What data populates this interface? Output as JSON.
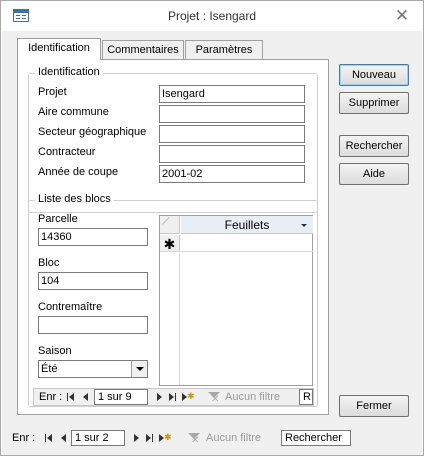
{
  "window": {
    "title": "Projet : Isengard",
    "close_glyph": "✕"
  },
  "tabs": [
    {
      "label": "Identification",
      "active": true
    },
    {
      "label": "Commentaires",
      "active": false
    },
    {
      "label": "Paramètres",
      "active": false
    }
  ],
  "identification": {
    "group_label": "Identification",
    "fields": [
      {
        "label": "Projet",
        "value": "Isengard"
      },
      {
        "label": "Aire commune",
        "value": ""
      },
      {
        "label": "Secteur géographique",
        "value": ""
      },
      {
        "label": "Contracteur",
        "value": ""
      },
      {
        "label": "Année de coupe",
        "value": "2001-02"
      }
    ]
  },
  "blocs": {
    "group_label": "Liste des blocs",
    "parcelle": {
      "label": "Parcelle",
      "value": "14360"
    },
    "bloc": {
      "label": "Bloc",
      "value": "104"
    },
    "contremaitre": {
      "label": "Contremaître",
      "value": ""
    },
    "saison": {
      "label": "Saison",
      "value": "Été"
    },
    "datasheet": {
      "column": "Feuillets",
      "new_row_marker": "✱"
    },
    "nav": {
      "prefix": "Enr :",
      "record": "1 sur 9",
      "filter": "Aucun filtre",
      "search": "R"
    }
  },
  "buttons": {
    "nouveau": "Nouveau",
    "supprimer": "Supprimer",
    "rechercher": "Rechercher",
    "aide": "Aide",
    "fermer": "Fermer"
  },
  "form_nav": {
    "prefix": "Enr :",
    "record": "1 sur 2",
    "filter": "Aucun filtre",
    "search": "Rechercher"
  },
  "colors": {
    "accent": "#3c7fb1",
    "icon_blue": "#3d6db3"
  }
}
